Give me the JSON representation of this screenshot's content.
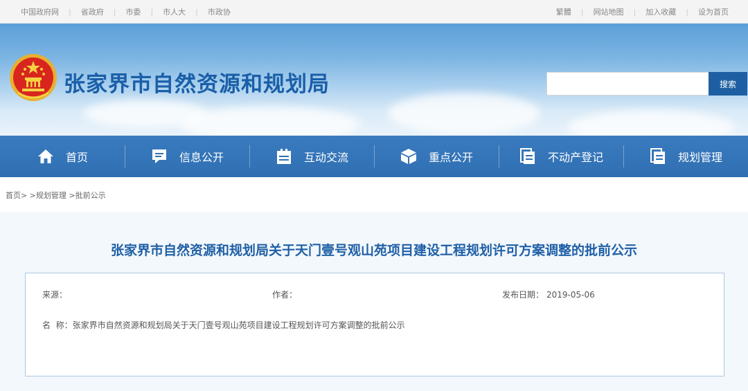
{
  "topbar": {
    "left_links": [
      "中国政府网",
      "省政府",
      "市委",
      "市人大",
      "市政协"
    ],
    "right_links": [
      "繁體",
      "网站地图",
      "加入收藏",
      "设为首页"
    ]
  },
  "header": {
    "title": "张家界市自然资源和规划局",
    "emblem_icon": "national-emblem-icon",
    "search": {
      "placeholder": "",
      "button_label": "搜索"
    }
  },
  "nav": {
    "items": [
      {
        "label": "首页",
        "icon": "home-icon"
      },
      {
        "label": "信息公开",
        "icon": "message-icon"
      },
      {
        "label": "互动交流",
        "icon": "clipboard-icon"
      },
      {
        "label": "重点公开",
        "icon": "cube-icon"
      },
      {
        "label": "不动产登记",
        "icon": "documents-icon"
      },
      {
        "label": "规划管理",
        "icon": "documents-icon"
      }
    ]
  },
  "breadcrumb": {
    "items": [
      "首页>",
      ">规划管理",
      ">批前公示"
    ]
  },
  "article": {
    "title": "张家界市自然资源和规划局关于天门壹号观山苑项目建设工程规划许可方案调整的批前公示",
    "source_label": "来源：",
    "source_value": "",
    "author_label": "作者：",
    "author_value": "",
    "date_label": "发布日期：",
    "date_value": "2019-05-06",
    "name_label": "名  称：",
    "name_value": "张家界市自然资源和规划局关于天门壹号观山苑项目建设工程规划许可方案调整的批前公示"
  },
  "colors": {
    "brand_blue": "#1a5fa8",
    "nav_blue": "#2f6fb2",
    "content_bg": "#f3f8fc",
    "box_border": "#aac8e6"
  }
}
